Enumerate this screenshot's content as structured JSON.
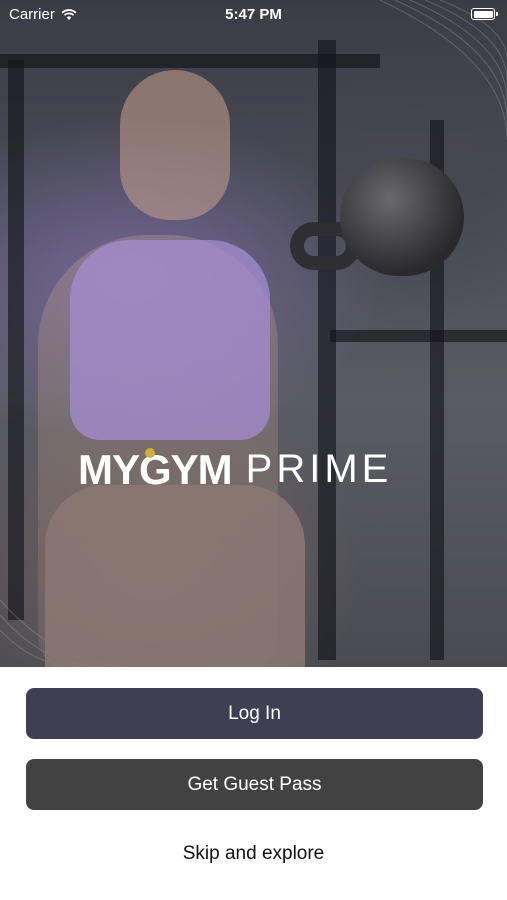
{
  "status_bar": {
    "carrier": "Carrier",
    "time": "5:47 PM"
  },
  "hero": {
    "logo": {
      "primary": "MYGYM",
      "secondary": "PRIME"
    }
  },
  "actions": {
    "login_label": "Log In",
    "guest_pass_label": "Get Guest Pass",
    "skip_label": "Skip and explore"
  },
  "colors": {
    "login_button": "#3f3e52",
    "guest_button": "#424242",
    "logo_accent": "#d4af37"
  },
  "icons": [
    "wifi-icon",
    "battery-icon"
  ]
}
